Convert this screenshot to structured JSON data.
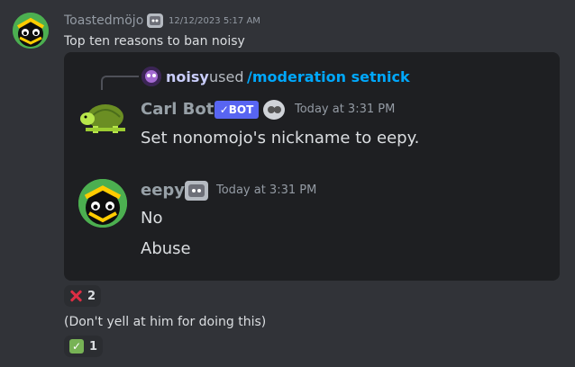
{
  "message": {
    "author": "Toastedmöjo",
    "timestamp": "12/12/2023 5:17 AM",
    "text": "Top ten reasons to ban noisy",
    "icons": {
      "avatar": "bee-avatar-icon",
      "badge": "robot-badge-icon"
    }
  },
  "embed": {
    "reply": {
      "user": "noisy",
      "action": "used",
      "command": "/moderation setnick"
    },
    "bot_message": {
      "author": "Carl Bot",
      "bot_tag": "✓BOT",
      "timestamp": "Today at 3:31 PM",
      "text": "Set nonomojo's nickname to eepy."
    },
    "user_message": {
      "author": "eepy",
      "timestamp": "Today at 3:31 PM",
      "line1": "No",
      "line2": "Abuse"
    }
  },
  "reactions": [
    {
      "emoji": "cross-mark-icon",
      "count": "2"
    },
    {
      "emoji": "check-mark-icon",
      "count": "1"
    }
  ],
  "followup": {
    "text": "(Don't yell at him for doing this)"
  },
  "colors": {
    "background": "#313338",
    "embed_bg": "#1e1f22",
    "command_link": "#00a8fc",
    "bot_tag": "#5865f2",
    "carl_name": "#97a0a7"
  }
}
